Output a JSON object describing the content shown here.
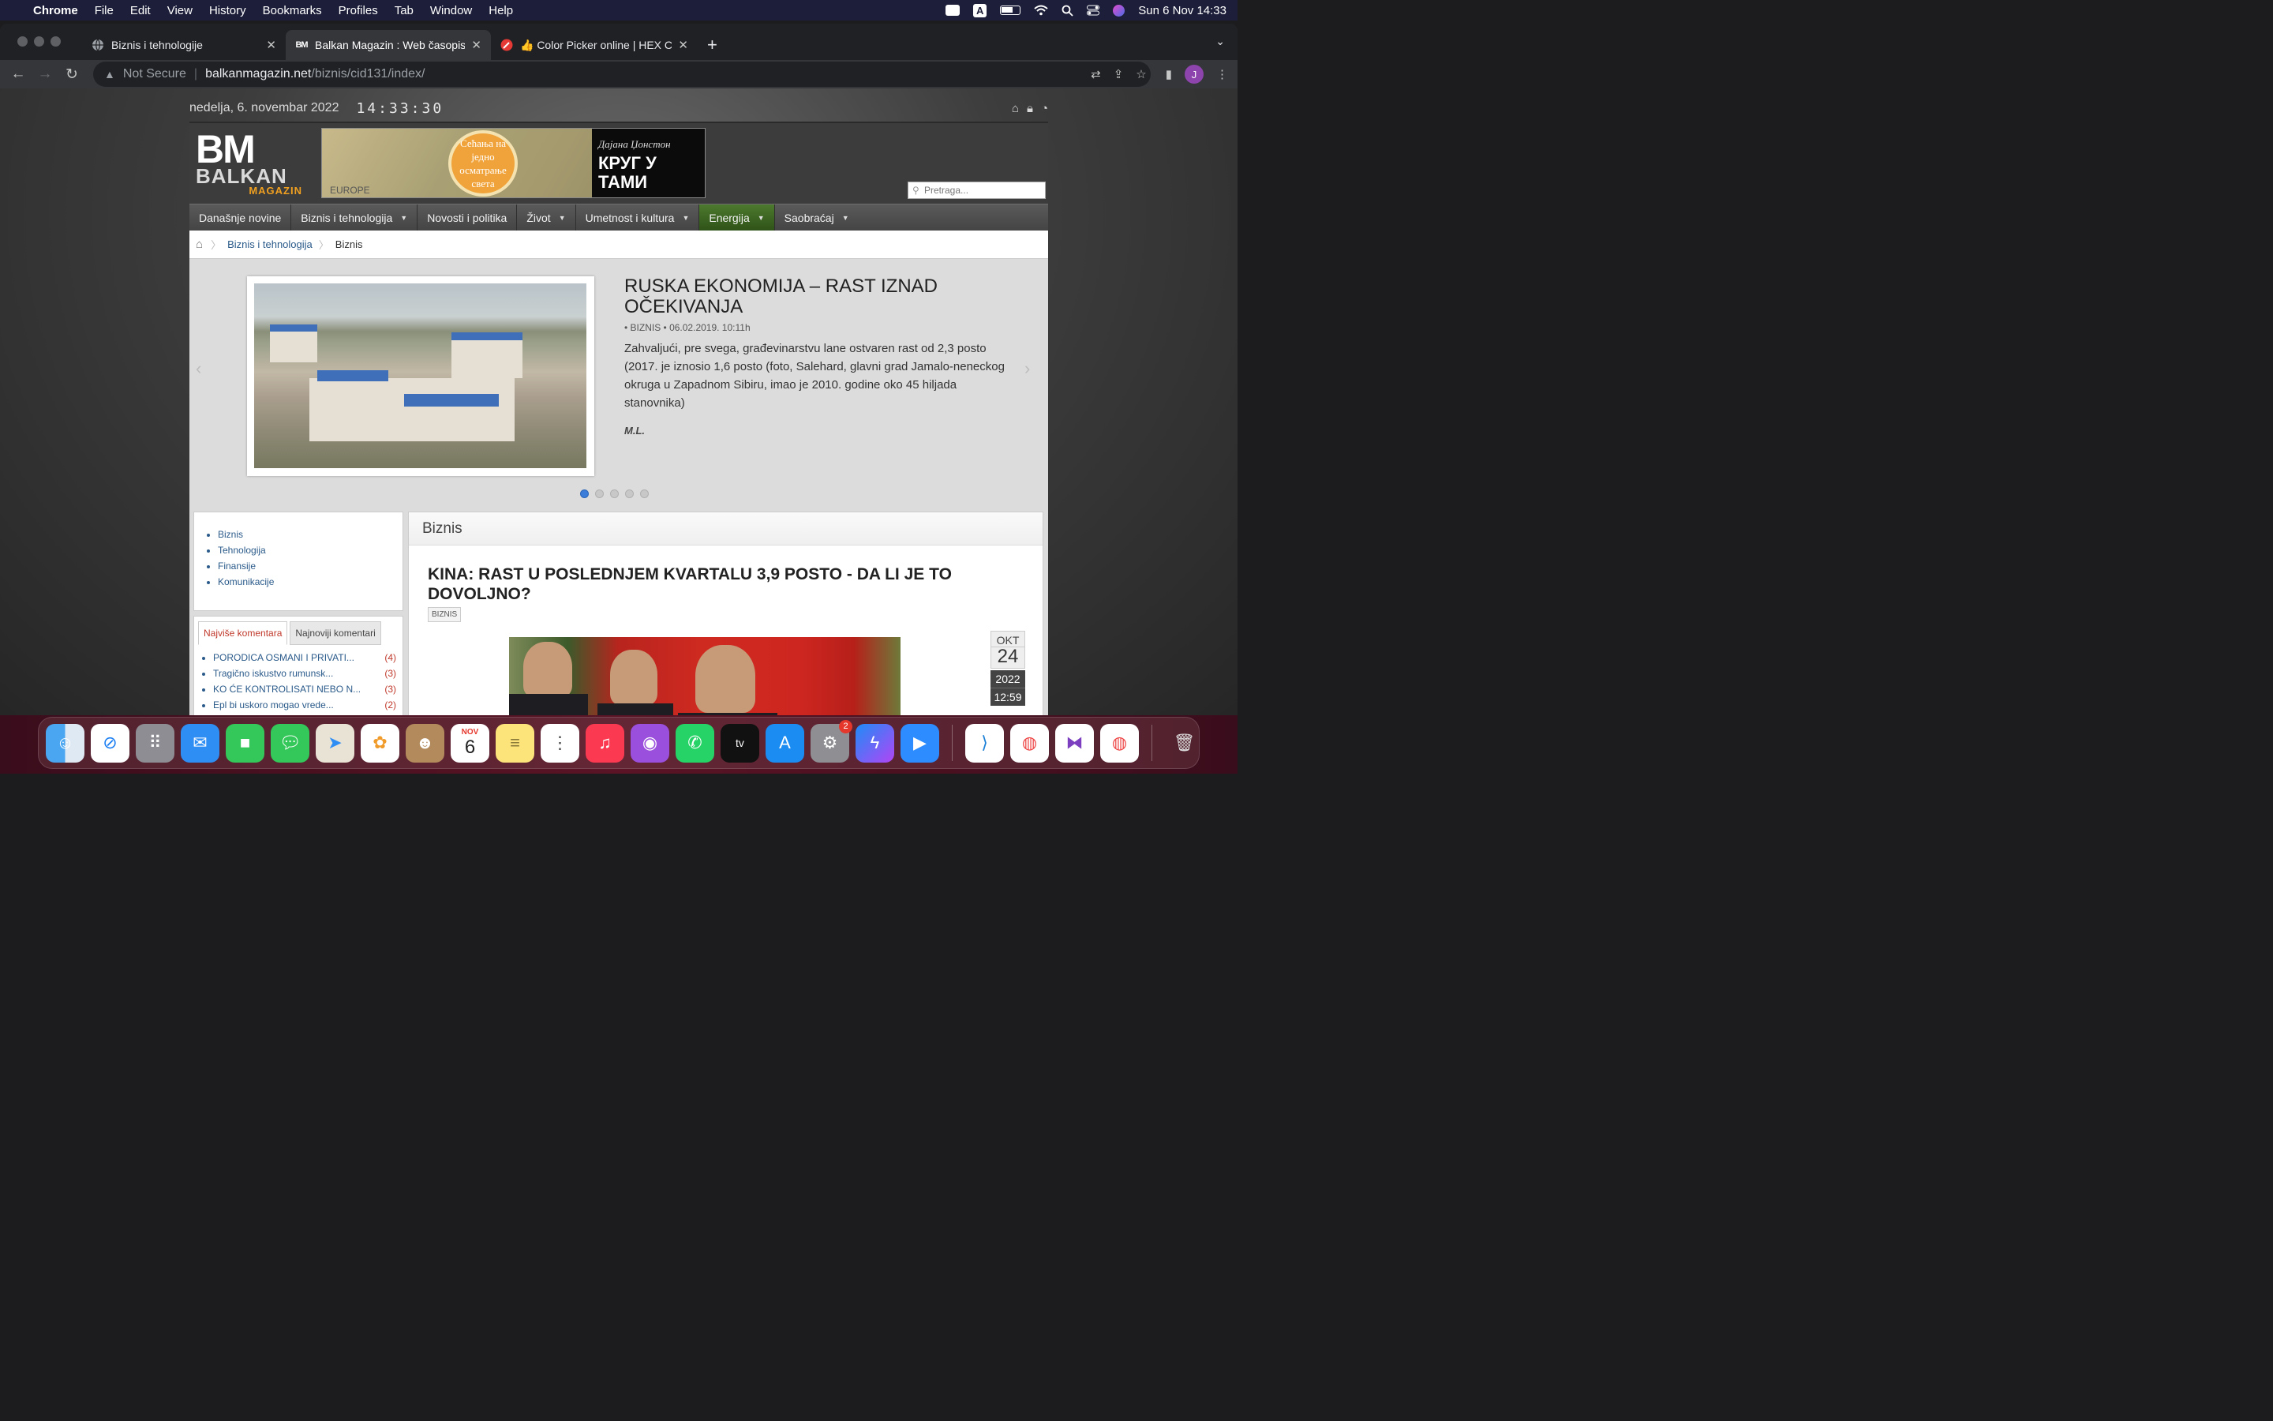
{
  "menubar": {
    "app_name": "Chrome",
    "items": [
      "File",
      "Edit",
      "View",
      "History",
      "Bookmarks",
      "Profiles",
      "Tab",
      "Window",
      "Help"
    ],
    "datetime": "Sun 6 Nov  14:33",
    "input_source": "A"
  },
  "browser": {
    "tabs": [
      {
        "title": "Biznis i tehnologije",
        "favicon": "globe-icon"
      },
      {
        "title": "Balkan Magazin : Web časopis",
        "favicon": "BM"
      },
      {
        "title": "👍 Color Picker online | HEX Co",
        "favicon": "color-picker-icon"
      }
    ],
    "security_label": "Not Secure",
    "url_host": "balkanmagazin.net",
    "url_path": "/biznis/cid131/index/",
    "profile_initial": "J"
  },
  "site": {
    "date": "nedelja, 6. novembar 2022",
    "clock": "14:33:30",
    "logo": {
      "mark": "BM",
      "name": "BALKAN",
      "sub": "MAGAZIN"
    },
    "banner": {
      "seal_text": "Сећања на једно осматрање света",
      "map_label": "EUROPE",
      "book_author": "Дајана Џонстон",
      "book_title": "КРУГ У ТАМИ"
    },
    "search_placeholder": "Pretraga...",
    "nav": [
      {
        "label": "Današnje novine",
        "dropdown": false
      },
      {
        "label": "Biznis i tehnologija",
        "dropdown": true
      },
      {
        "label": "Novosti i politika",
        "dropdown": false
      },
      {
        "label": "Život",
        "dropdown": true
      },
      {
        "label": "Umetnost i kultura",
        "dropdown": true
      },
      {
        "label": "Energija",
        "dropdown": true
      },
      {
        "label": "Saobraćaj",
        "dropdown": true
      }
    ],
    "breadcrumb": {
      "parent": "Biznis i tehnologija",
      "current": "Biznis"
    },
    "slide": {
      "title": "RUSKA EKONOMIJA – RAST IZNAD OČEKIVANJA",
      "meta": "• BIZNIS • 06.02.2019. 10:11h",
      "text": "Zahvaljući, pre svega, građevinarstvu lane ostvaren rast od 2,3 posto (2017. je iznosio 1,6 posto (foto, Salehard, glavni grad Jamalo-neneckog okruga u Zapadnom Sibiru, imao je 2010. godine oko 45 hiljada stanovnika)",
      "author": "M.L."
    },
    "sidebar_links": [
      "Biznis",
      "Tehnologija",
      "Finansije",
      "Komunikacije"
    ],
    "comment_tabs": {
      "most": "Najviše komentara",
      "newest": "Najnoviji komentari"
    },
    "comments": [
      {
        "title": "PORODICA OSMANI I PRIVATI...",
        "count": "(4)"
      },
      {
        "title": "Tragično iskustvo rumunsk...",
        "count": "(3)"
      },
      {
        "title": "KO ĆE KONTROLISATI NEBO N...",
        "count": "(3)"
      },
      {
        "title": "Epl bi uskoro mogao vrede...",
        "count": "(2)"
      }
    ],
    "section_title": "Biznis",
    "article": {
      "title": "KINA: RAST U POSLEDNJEM KVARTALU 3,9 POSTO - DA LI JE TO DOVOLJNO?",
      "tag": "BIZNIS",
      "date_month": "OKT",
      "date_day": "24",
      "date_year": "2022",
      "date_time": "12:59"
    }
  },
  "dock": {
    "apps": [
      "finder-icon",
      "safari-icon",
      "launchpad-icon",
      "mail-icon",
      "facetime-icon",
      "messages-icon",
      "maps-icon",
      "photos-icon",
      "contacts-icon",
      "calendar-icon",
      "notes-icon",
      "reminders-icon",
      "music-icon",
      "podcasts-icon",
      "whatsapp-icon",
      "appletv-icon",
      "appstore-icon",
      "system-preferences-icon",
      "messenger-icon",
      "zoom-icon",
      "vscode-icon",
      "chrome-icon",
      "visual-studio-icon",
      "chrome-icon",
      "trash-icon"
    ],
    "calendar_month": "NOV",
    "calendar_day": "6",
    "settings_badge": "2"
  }
}
